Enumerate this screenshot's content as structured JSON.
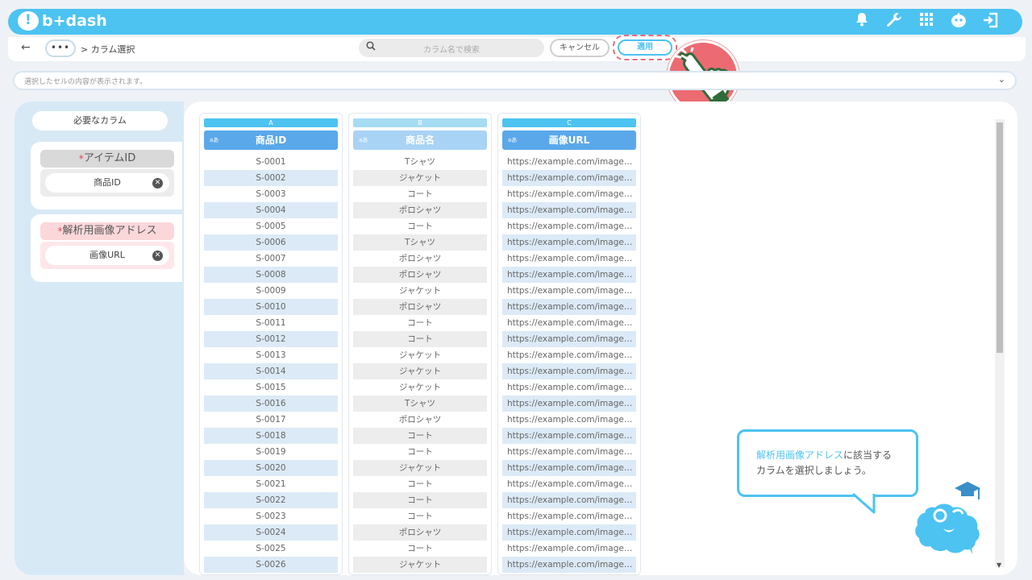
{
  "header": {
    "logo_text": "b+dash",
    "icons": [
      "bell-icon",
      "wrench-icon",
      "grid-icon",
      "robot-icon",
      "logout-icon"
    ]
  },
  "toolbar": {
    "back_icon": "←",
    "more_label": "•••",
    "breadcrumb": "> カラム選択",
    "search_placeholder": "カラム名で検索",
    "cancel_label": "キャンセル",
    "apply_label": "適用"
  },
  "cellbar": {
    "text": "選択したセルの内容が表示されます。"
  },
  "left_panel": {
    "required_label": "必要なカラム",
    "cards": [
      {
        "star": "*",
        "title": "アイテムID",
        "chip": "商品ID"
      },
      {
        "star": "*",
        "title": "解析用画像アドレス",
        "chip": "画像URL"
      }
    ]
  },
  "columns": [
    {
      "letter": "A",
      "tag": "aあ",
      "header": "商品ID"
    },
    {
      "letter": "B",
      "tag": "aあ",
      "header": "商品名"
    },
    {
      "letter": "C",
      "tag": "aあ",
      "header": "画像URL"
    }
  ],
  "rows": [
    [
      "S-0001",
      "Tシャツ",
      "https://example.com/images/S-..."
    ],
    [
      "S-0002",
      "ジャケット",
      "https://example.com/images/S-..."
    ],
    [
      "S-0003",
      "コート",
      "https://example.com/images/S-..."
    ],
    [
      "S-0004",
      "ポロシャツ",
      "https://example.com/images/S-..."
    ],
    [
      "S-0005",
      "コート",
      "https://example.com/images/S-..."
    ],
    [
      "S-0006",
      "Tシャツ",
      "https://example.com/images/S-..."
    ],
    [
      "S-0007",
      "ポロシャツ",
      "https://example.com/images/S-..."
    ],
    [
      "S-0008",
      "ポロシャツ",
      "https://example.com/images/S-..."
    ],
    [
      "S-0009",
      "ジャケット",
      "https://example.com/images/S-..."
    ],
    [
      "S-0010",
      "ポロシャツ",
      "https://example.com/images/S-..."
    ],
    [
      "S-0011",
      "コート",
      "https://example.com/images/S-..."
    ],
    [
      "S-0012",
      "コート",
      "https://example.com/images/S-..."
    ],
    [
      "S-0013",
      "ジャケット",
      "https://example.com/images/S-..."
    ],
    [
      "S-0014",
      "ジャケット",
      "https://example.com/images/S-..."
    ],
    [
      "S-0015",
      "ジャケット",
      "https://example.com/images/S-..."
    ],
    [
      "S-0016",
      "Tシャツ",
      "https://example.com/images/S-..."
    ],
    [
      "S-0017",
      "ポロシャツ",
      "https://example.com/images/S-..."
    ],
    [
      "S-0018",
      "コート",
      "https://example.com/images/S-..."
    ],
    [
      "S-0019",
      "コート",
      "https://example.com/images/S-..."
    ],
    [
      "S-0020",
      "ジャケット",
      "https://example.com/images/S-..."
    ],
    [
      "S-0021",
      "コート",
      "https://example.com/images/S-..."
    ],
    [
      "S-0022",
      "コート",
      "https://example.com/images/S-..."
    ],
    [
      "S-0023",
      "コート",
      "https://example.com/images/S-..."
    ],
    [
      "S-0024",
      "ポロシャツ",
      "https://example.com/images/S-..."
    ],
    [
      "S-0025",
      "コート",
      "https://example.com/images/S-..."
    ],
    [
      "S-0026",
      "ジャケット",
      "https://example.com/images/S-..."
    ]
  ],
  "hint": {
    "highlight": "解析用画像アドレス",
    "text_1": "に該当する",
    "text_2": "カラムを選択しましょう。"
  },
  "colors": {
    "accent": "#4cc3f1",
    "header_blue": "#5aa8ea",
    "pointer_red": "#ec6b72"
  }
}
